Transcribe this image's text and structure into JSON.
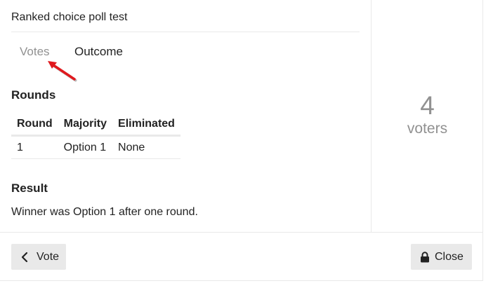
{
  "poll": {
    "title": "Ranked choice poll test",
    "tabs": [
      {
        "label": "Votes",
        "active": false
      },
      {
        "label": "Outcome",
        "active": true
      }
    ],
    "rounds": {
      "heading": "Rounds",
      "columns": [
        "Round",
        "Majority",
        "Eliminated"
      ],
      "rows": [
        [
          "1",
          "Option 1",
          "None"
        ]
      ]
    },
    "result": {
      "heading": "Result",
      "text": "Winner was Option 1 after one round."
    },
    "voters": {
      "count": "4",
      "label": "voters"
    }
  },
  "footer": {
    "vote_button": {
      "label": "Vote",
      "icon": "chevron-left-icon"
    },
    "close_button": {
      "label": "Close",
      "icon": "lock-icon"
    }
  },
  "annotation": {
    "icon": "red-arrow-annotation",
    "color": "#e0191e"
  },
  "colors": {
    "text": "#222222",
    "muted": "#919191",
    "border": "#e9e9e9",
    "button_bg": "#e9e9e9"
  }
}
